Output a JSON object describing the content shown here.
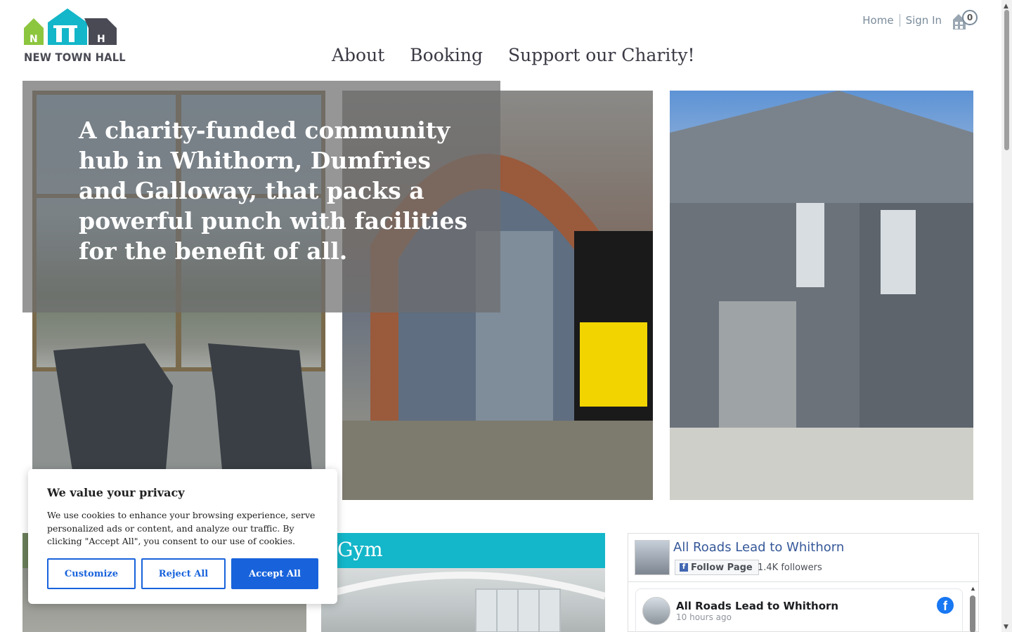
{
  "brand": {
    "name": "NEW TOWN HALL"
  },
  "top_links": {
    "home": "Home",
    "signin": "Sign In"
  },
  "cart": {
    "count": "0",
    "icon": "basket-icon"
  },
  "nav": {
    "items": [
      "About",
      "Booking",
      "Support our Charity!"
    ]
  },
  "hero": {
    "tagline": "A charity-funded community hub in Whithorn, Dumfries and Galloway, that packs a powerful punch with facilities for the benefit of all."
  },
  "cards": {
    "gym_title": "Gym"
  },
  "facebook": {
    "page_name": "All Roads Lead to Whithorn",
    "follow_label": "Follow Page",
    "followers": "1.4K followers",
    "post": {
      "author": "All Roads Lead to Whithorn",
      "time": "10 hours ago"
    }
  },
  "cookie": {
    "title": "We value your privacy",
    "body": "We use cookies to enhance your browsing experience, serve personalized ads or content, and analyze our traffic. By clicking \"Accept All\", you consent to our use of cookies.",
    "customize": "Customize",
    "reject": "Reject All",
    "accept": "Accept All"
  },
  "colors": {
    "accent": "#14b6c9",
    "cookie_button": "#1863dc",
    "facebook_blue": "#1877f2",
    "logo_green": "#8cc63f",
    "logo_teal": "#14b6c9",
    "logo_dark": "#4a4a55"
  }
}
